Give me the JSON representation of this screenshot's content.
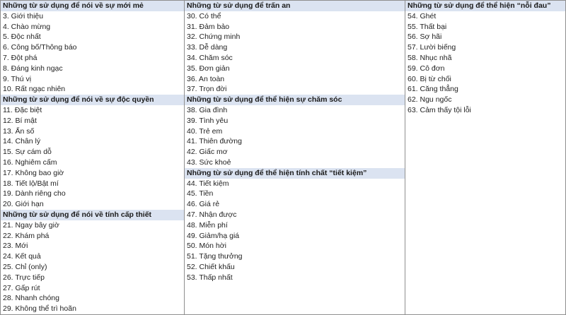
{
  "columns": [
    {
      "sections": [
        {
          "title": "Những từ sử dụng để nói về sự mới mẻ",
          "items": [
            "3. Giới thiệu",
            "4. Chào mừng",
            "5. Độc nhất",
            "6. Công bố/Thông báo",
            "7. Đột phá",
            "8. Đáng kinh ngạc",
            "9. Thú vị",
            "10. Rất ngạc nhiên"
          ]
        },
        {
          "title": "Những từ sử dụng để nói về sự độc quyền",
          "items": [
            "11. Đặc biệt",
            "12. Bí mật",
            "13. Ẩn số",
            "14. Chân lý",
            "15. Sự cám dỗ",
            "16. Nghiêm cấm",
            "17. Không bao giờ",
            "18. Tiết lộ/Bật mí",
            "19. Dành riêng cho",
            "20. Giới hạn"
          ]
        },
        {
          "title": "Những từ sử dụng để nói về tính cấp thiết",
          "items": [
            "21. Ngay bây giờ",
            "22. Khám phá",
            "23. Mới",
            "24. Kết quả",
            "25. Chỉ (only)",
            "26. Trực tiếp",
            "27. Gấp rút",
            "28. Nhanh chóng",
            "29. Không thể trì hoãn"
          ]
        }
      ]
    },
    {
      "sections": [
        {
          "title": "Những từ sử dụng để trấn an",
          "items": [
            "30. Có thể",
            "31. Đảm bảo",
            "32. Chứng minh",
            "33. Dễ dàng",
            "34. Chăm sóc",
            "35. Đơn giản",
            "36. An toàn",
            "37. Trọn đời"
          ]
        },
        {
          "title": "Những từ sử dụng để thể hiện sự chăm sóc",
          "items": [
            "38. Gia đình",
            "39. Tình yêu",
            "40. Trẻ em",
            "41. Thiên đường",
            "42. Giấc mơ",
            "43. Sức khoẻ"
          ]
        },
        {
          "title": "Những từ sử dụng để thể hiện tính chất “tiết kiệm”",
          "items": [
            "44. Tiết kiệm",
            "45. Tiền",
            "46. Giá rẻ",
            "47. Nhận được",
            "48. Miễn phí",
            "49. Giảm/hạ giá",
            "50. Món hời",
            "51. Tặng thưởng",
            "52. Chiết khấu",
            "53. Thấp nhất"
          ]
        }
      ]
    },
    {
      "sections": [
        {
          "title": "Những từ sử dụng để thể hiện “nỗi đau”",
          "items": [
            "54. Ghét",
            "55. Thất bại",
            "56. Sợ hãi",
            "57. Lười biếng",
            "58. Nhục nhã",
            "59. Cô đơn",
            "60. Bị từ chối",
            "61. Căng thẳng",
            "62. Ngu ngốc",
            "63. Cảm thấy tội lỗi"
          ]
        }
      ]
    }
  ]
}
